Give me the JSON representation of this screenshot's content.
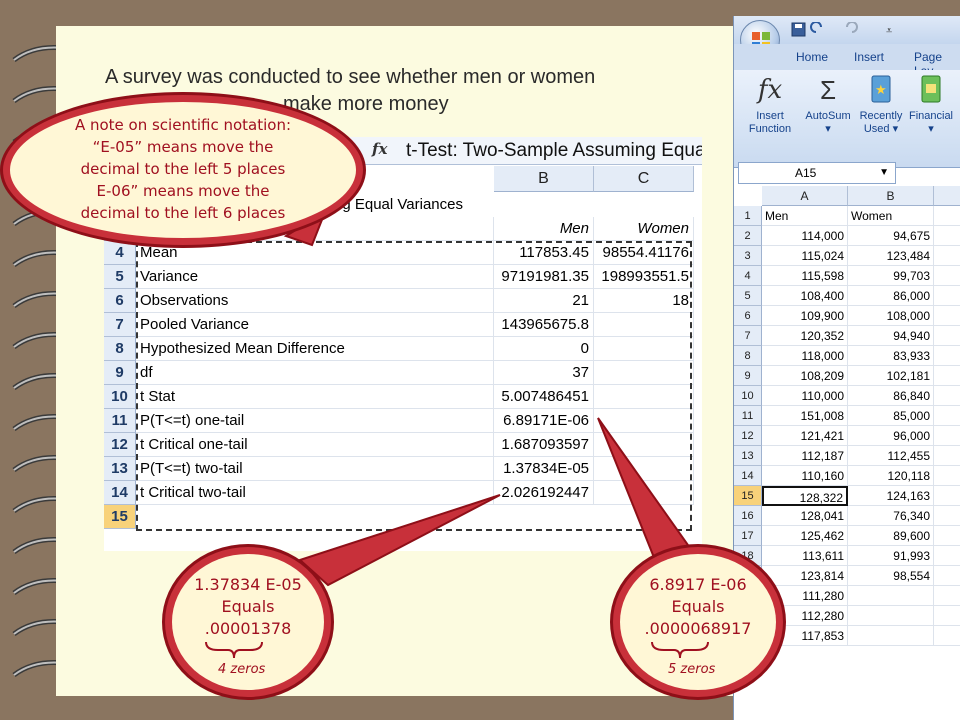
{
  "title_line1": "A survey was conducted to see whether men or women",
  "title_line2": "make more money",
  "note": {
    "line1": "A note on scientific notation:",
    "line2": "“E-05” means move the",
    "line3": "decimal to the left 5 places",
    "line4": "E-06” means move the",
    "line5": "decimal to the left 6 places"
  },
  "ttest": {
    "formula_bar": "t-Test: Two-Sample Assuming Equal Vari",
    "row2_text": "ng Equal Variances",
    "columns": [
      "B",
      "C"
    ],
    "header_row": {
      "row": "3",
      "men": "Men",
      "women": "Women"
    },
    "rows": [
      {
        "row": "4",
        "label": "Mean",
        "men": "117853.45",
        "women": "98554.41176"
      },
      {
        "row": "5",
        "label": "Variance",
        "men": "97191981.35",
        "women": "198993551.5"
      },
      {
        "row": "6",
        "label": "Observations",
        "men": "21",
        "women": "18"
      },
      {
        "row": "7",
        "label": "Pooled Variance",
        "men": "143965675.8",
        "women": ""
      },
      {
        "row": "8",
        "label": "Hypothesized Mean Difference",
        "men": "0",
        "women": ""
      },
      {
        "row": "9",
        "label": "df",
        "men": "37",
        "women": ""
      },
      {
        "row": "10",
        "label": "t Stat",
        "men": "5.007486451",
        "women": ""
      },
      {
        "row": "11",
        "label": "P(T<=t) one-tail",
        "men": "6.89171E-06",
        "women": ""
      },
      {
        "row": "12",
        "label": "t Critical one-tail",
        "men": "1.687093597",
        "women": ""
      },
      {
        "row": "13",
        "label": "P(T<=t) two-tail",
        "men": "1.37834E-05",
        "women": ""
      },
      {
        "row": "14",
        "label": "t Critical two-tail",
        "men": "2.026192447",
        "women": ""
      }
    ],
    "last_row": "15"
  },
  "callout_left": {
    "line1": "1.37834 E-05",
    "line2": "Equals",
    "line3": ".00001378",
    "brace": "4 zeros"
  },
  "callout_right": {
    "line1": "6.8917 E-06",
    "line2": "Equals",
    "line3": ".0000068917",
    "brace": "5 zeros"
  },
  "excel": {
    "tabs": [
      "Home",
      "Insert",
      "Page Lay"
    ],
    "ribbon": [
      {
        "icon": "fx-icon",
        "label1": "Insert",
        "label2": "Function"
      },
      {
        "icon": "sigma-icon",
        "label1": "AutoSum",
        "label2": "▾"
      },
      {
        "icon": "star-book-icon",
        "label1": "Recently",
        "label2": "Used ▾"
      },
      {
        "icon": "money-book-icon",
        "label1": "Financial",
        "label2": "▾"
      }
    ],
    "name_box": "A15",
    "columns": [
      "A",
      "B"
    ],
    "rows": [
      {
        "row": "1",
        "a": "Men",
        "b": "Women"
      },
      {
        "row": "2",
        "a": "114,000",
        "b": "94,675"
      },
      {
        "row": "3",
        "a": "115,024",
        "b": "123,484"
      },
      {
        "row": "4",
        "a": "115,598",
        "b": "99,703"
      },
      {
        "row": "5",
        "a": "108,400",
        "b": "86,000"
      },
      {
        "row": "6",
        "a": "109,900",
        "b": "108,000"
      },
      {
        "row": "7",
        "a": "120,352",
        "b": "94,940"
      },
      {
        "row": "8",
        "a": "118,000",
        "b": "83,933"
      },
      {
        "row": "9",
        "a": "108,209",
        "b": "102,181"
      },
      {
        "row": "10",
        "a": "110,000",
        "b": "86,840"
      },
      {
        "row": "11",
        "a": "151,008",
        "b": "85,000"
      },
      {
        "row": "12",
        "a": "121,421",
        "b": "96,000"
      },
      {
        "row": "13",
        "a": "112,187",
        "b": "112,455"
      },
      {
        "row": "14",
        "a": "110,160",
        "b": "120,118"
      },
      {
        "row": "15",
        "a": "128,322",
        "b": "124,163"
      },
      {
        "row": "16",
        "a": "128,041",
        "b": "76,340"
      },
      {
        "row": "17",
        "a": "125,462",
        "b": "89,600"
      },
      {
        "row": "18",
        "a": "113,611",
        "b": "91,993"
      },
      {
        "row": "19",
        "a": "123,814",
        "b": "98,554"
      },
      {
        "row": "20",
        "a": "111,280",
        "b": ""
      },
      {
        "row": "21",
        "a": "112,280",
        "b": ""
      },
      {
        "row": "22",
        "a": "117,853",
        "b": ""
      }
    ]
  },
  "colors": {
    "accent_red": "#c8303a",
    "selection": "#f8d27a"
  }
}
